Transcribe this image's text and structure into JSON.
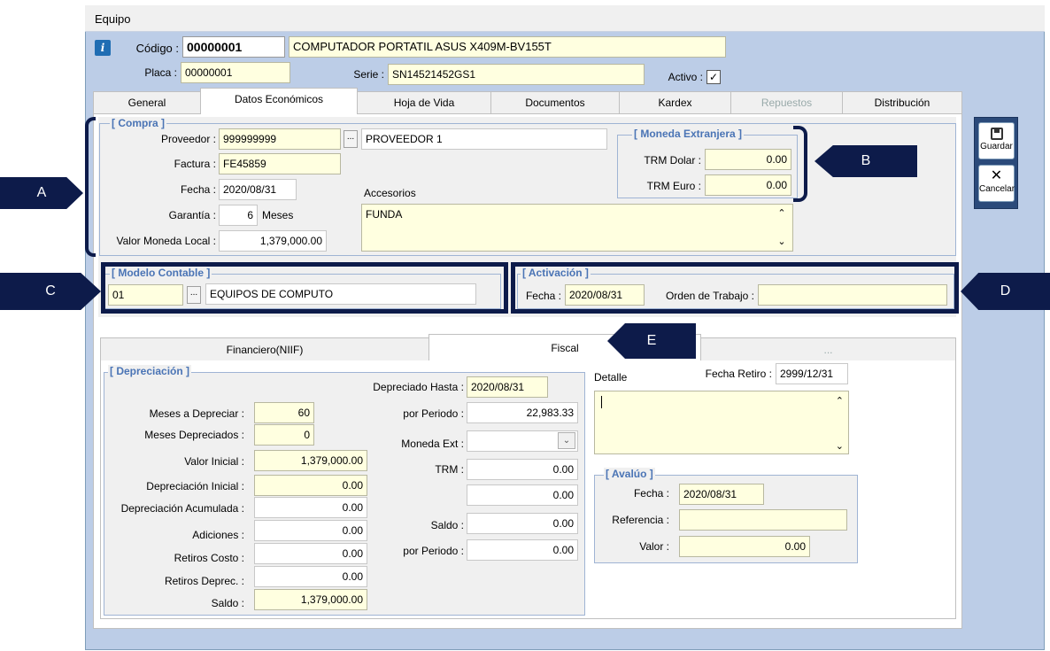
{
  "window": {
    "title": "Equipo"
  },
  "header": {
    "codigo_label": "Código :",
    "codigo_value": "00000001",
    "descripcion": "COMPUTADOR PORTATIL ASUS X409M-BV155T",
    "placa_label": "Placa :",
    "placa_value": "00000001",
    "serie_label": "Serie :",
    "serie_value": "SN14521452GS1",
    "activo_label": "Activo :",
    "activo_check": "✓"
  },
  "tabs": [
    {
      "label": "General"
    },
    {
      "label": "Datos Económicos"
    },
    {
      "label": "Hoja de Vida"
    },
    {
      "label": "Documentos"
    },
    {
      "label": "Kardex"
    },
    {
      "label": "Repuestos"
    },
    {
      "label": "Distribución"
    }
  ],
  "compra": {
    "title": "[ Compra ]",
    "proveedor_label": "Proveedor :",
    "proveedor_value": "999999999",
    "proveedor_name": "PROVEEDOR 1",
    "factura_label": "Factura :",
    "factura_value": "FE45859",
    "fecha_label": "Fecha :",
    "fecha_value": "2020/08/31",
    "garantia_label": "Garantía :",
    "garantia_value": "6",
    "garantia_unit": "Meses",
    "valor_label": "Valor Moneda Local :",
    "valor_value": "1,379,000.00",
    "accesorios_label": "Accesorios",
    "accesorios_value": "FUNDA"
  },
  "moneda": {
    "title": "[ Moneda Extranjera ]",
    "dolar_label": "TRM Dolar :",
    "dolar_value": "0.00",
    "euro_label": "TRM Euro :",
    "euro_value": "0.00"
  },
  "modelo": {
    "title": "[ Modelo Contable ]",
    "code": "01",
    "name": "EQUIPOS DE COMPUTO"
  },
  "activacion": {
    "title": "[ Activación ]",
    "fecha_label": "Fecha :",
    "fecha_value": "2020/08/31",
    "orden_label": "Orden de Trabajo :",
    "orden_value": ""
  },
  "subtabs": [
    {
      "label": "Financiero(NIIF)"
    },
    {
      "label": "Fiscal"
    },
    {
      "label": "..."
    }
  ],
  "depreciacion": {
    "title": "[ Depreciación ]",
    "hasta_label": "Depreciado Hasta :",
    "hasta_value": "2020/08/31",
    "meses_dep_label": "Meses a Depreciar :",
    "meses_dep_value": "60",
    "meses_depd_label": "Meses Depreciados :",
    "meses_depd_value": "0",
    "valor_ini_label": "Valor Inicial :",
    "valor_ini_value": "1,379,000.00",
    "dep_ini_label": "Depreciación Inicial :",
    "dep_ini_value": "0.00",
    "dep_acum_label": "Depreciación Acumulada :",
    "dep_acum_value": "0.00",
    "adiciones_label": "Adiciones :",
    "adiciones_value": "0.00",
    "ret_costo_label": "Retiros Costo :",
    "ret_costo_value": "0.00",
    "ret_deprec_label": "Retiros Deprec. :",
    "ret_deprec_value": "0.00",
    "saldo_label": "Saldo :",
    "saldo_value": "1,379,000.00",
    "por_periodo_label": "por Periodo :",
    "por_periodo_value": "22,983.33",
    "moneda_ext_label": "Moneda Ext :",
    "moneda_ext_value": "",
    "trm_label": "TRM :",
    "trm_value": "0.00",
    "trm2_value": "0.00",
    "saldo2_label": "Saldo :",
    "saldo2_value": "0.00",
    "por_periodo2_label": "por Periodo :",
    "por_periodo2_value": "0.00"
  },
  "detalle": {
    "label": "Detalle",
    "fecha_retiro_label": "Fecha Retiro :",
    "fecha_retiro_value": "2999/12/31"
  },
  "avaluo": {
    "title": "[ Avalúo ]",
    "fecha_label": "Fecha :",
    "fecha_value": "2020/08/31",
    "ref_label": "Referencia :",
    "ref_value": "",
    "valor_label": "Valor :",
    "valor_value": "0.00"
  },
  "toolbar": {
    "guardar": "Guardar",
    "cancelar": "Cancelar"
  },
  "markers": {
    "a": "A",
    "b": "B",
    "c": "C",
    "d": "D",
    "e": "E"
  }
}
